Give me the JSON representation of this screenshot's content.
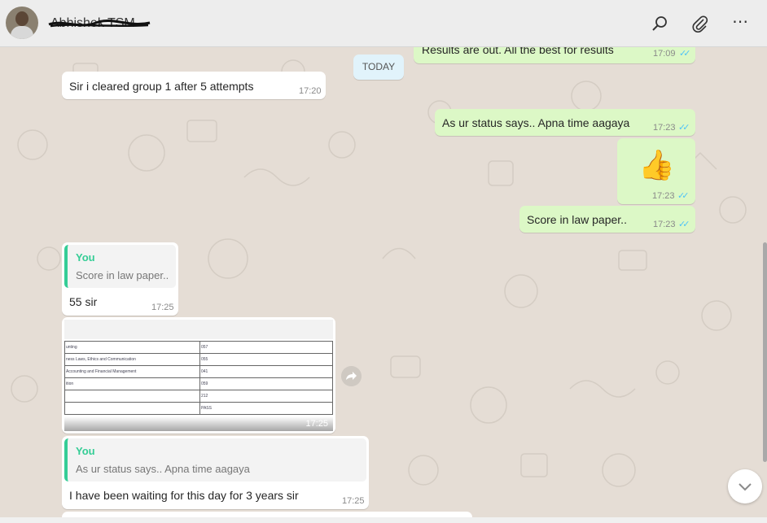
{
  "header": {
    "contact_name": "Abhishek TSM",
    "icons": [
      "search-icon",
      "attach-icon",
      "menu-icon"
    ],
    "menu_glyph": "⋯"
  },
  "colors": {
    "incoming": "#ffffff",
    "outgoing": "#dcf8c6",
    "background": "#e5ddd5",
    "quote_accent": "#35cd96",
    "tick": "#4fc3f7"
  },
  "date_chip": "TODAY",
  "messages": {
    "m0": {
      "text": "Results are out. All the best for results",
      "time": "17:09"
    },
    "m1": {
      "text": "Sir i cleared group 1 after 5 attempts",
      "time": "17:20"
    },
    "m2": {
      "text": "As ur status says.. Apna time aagaya",
      "time": "17:23"
    },
    "m3": {
      "emoji": "👍",
      "time": "17:23"
    },
    "m4": {
      "text": "Score in law paper..",
      "time": "17:23"
    },
    "m5": {
      "quote_author": "You",
      "quote_text": "Score in law paper..",
      "text": "55 sir",
      "time": "17:25"
    },
    "m6": {
      "time": "17:25",
      "rows": [
        {
          "subject": "unting",
          "marks": "057"
        },
        {
          "subject": "ness Laws, Ethics and Communication",
          "marks": "055"
        },
        {
          "subject": "Accounting and Financial Management",
          "marks": "041"
        },
        {
          "subject": "ition",
          "marks": "059"
        },
        {
          "subject": "",
          "marks": "212"
        },
        {
          "subject": "",
          "marks": "PASS"
        }
      ]
    },
    "m7": {
      "quote_author": "You",
      "quote_text": "As ur status says.. Apna time aagaya",
      "text": "I have been waiting for this day for 3 years sir",
      "time": "17:25"
    }
  },
  "ticks": "✓✓"
}
